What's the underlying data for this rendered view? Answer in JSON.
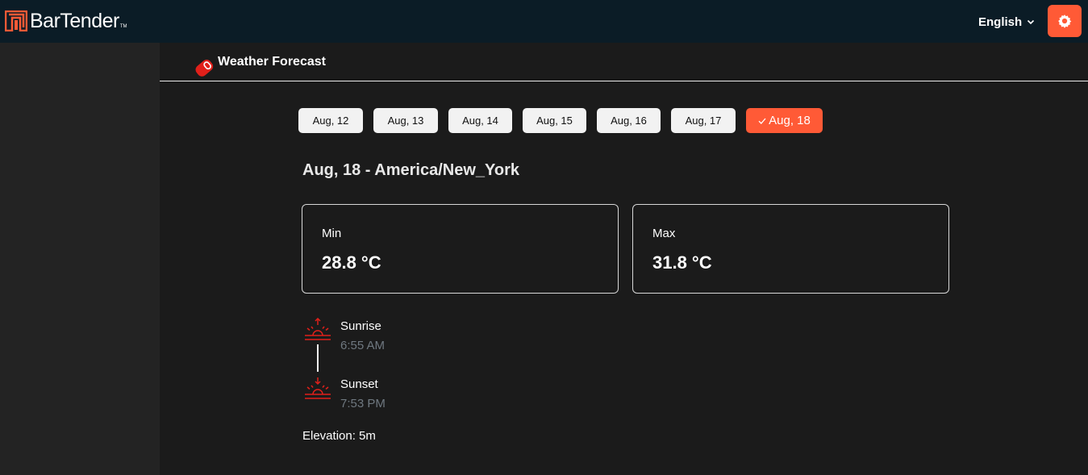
{
  "app": {
    "logo_text": "BarTender",
    "logo_tm": "TM",
    "language": "English"
  },
  "page": {
    "title": "Weather Forecast"
  },
  "dates": [
    {
      "label": "Aug, 12",
      "active": false
    },
    {
      "label": "Aug, 13",
      "active": false
    },
    {
      "label": "Aug, 14",
      "active": false
    },
    {
      "label": "Aug, 15",
      "active": false
    },
    {
      "label": "Aug, 16",
      "active": false
    },
    {
      "label": "Aug, 17",
      "active": false
    },
    {
      "label": "Aug, 18",
      "active": true
    }
  ],
  "forecast": {
    "heading": "Aug, 18 - America/New_York",
    "min_label": "Min",
    "min_value": "28.8 °C",
    "max_label": "Max",
    "max_value": "31.8 °C",
    "sunrise_label": "Sunrise",
    "sunrise_time": "6:55 AM",
    "sunset_label": "Sunset",
    "sunset_time": "7:53 PM",
    "elevation": "Elevation: 5m"
  },
  "icons": {
    "logo": "bartender-logo-icon",
    "language_chevron": "chevron-down-icon",
    "settings": "gear-icon",
    "page": "tag-icon",
    "check": "check-icon",
    "sunrise": "sunrise-icon",
    "sunset": "sunset-icon"
  },
  "colors": {
    "accent": "#ff5a36",
    "topbar": "#0b1c26",
    "background": "#1b1b1b",
    "sidebar": "#232323",
    "muted_text": "#6f7880",
    "icon_red": "#e0201a"
  }
}
